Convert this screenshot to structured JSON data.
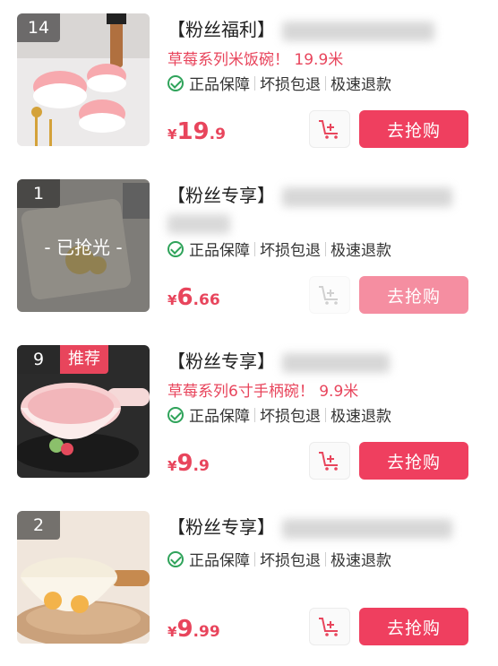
{
  "items": [
    {
      "rank": "14",
      "tag_label": "【粉丝福利】",
      "subtitle": "草莓系列米饭碗！ 19.9米",
      "guarantees": [
        "正品保障",
        "坏损包退",
        "极速退款"
      ],
      "price": {
        "currency": "¥",
        "int": "19",
        "dec": ".9"
      },
      "buy_label": "去抢购",
      "sold_out": false,
      "hot_badge": ""
    },
    {
      "rank": "1",
      "tag_label": "【粉丝专享】",
      "subtitle": "",
      "guarantees": [
        "正品保障",
        "坏损包退",
        "极速退款"
      ],
      "price": {
        "currency": "¥",
        "int": "6",
        "dec": ".66"
      },
      "buy_label": "去抢购",
      "sold_out": true,
      "sold_out_label": "- 已抢光 -",
      "hot_badge": ""
    },
    {
      "rank": "9",
      "tag_label": "【粉丝专享】",
      "subtitle": "草莓系列6寸手柄碗！ 9.9米",
      "guarantees": [
        "正品保障",
        "坏损包退",
        "极速退款"
      ],
      "price": {
        "currency": "¥",
        "int": "9",
        "dec": ".9"
      },
      "buy_label": "去抢购",
      "sold_out": false,
      "hot_badge": "推荐"
    },
    {
      "rank": "2",
      "tag_label": "【粉丝专享】",
      "subtitle": "",
      "guarantees": [
        "正品保障",
        "坏损包退",
        "极速退款"
      ],
      "price": {
        "currency": "¥",
        "int": "9",
        "dec": ".99"
      },
      "buy_label": "去抢购",
      "sold_out": false,
      "hot_badge": ""
    }
  ],
  "colors": {
    "accent": "#ef3f5f",
    "accent_disabled": "#f58ea1",
    "check": "#2fa35a"
  },
  "icons": {
    "cart": "add-to-cart-icon",
    "check": "check-circle-icon"
  }
}
